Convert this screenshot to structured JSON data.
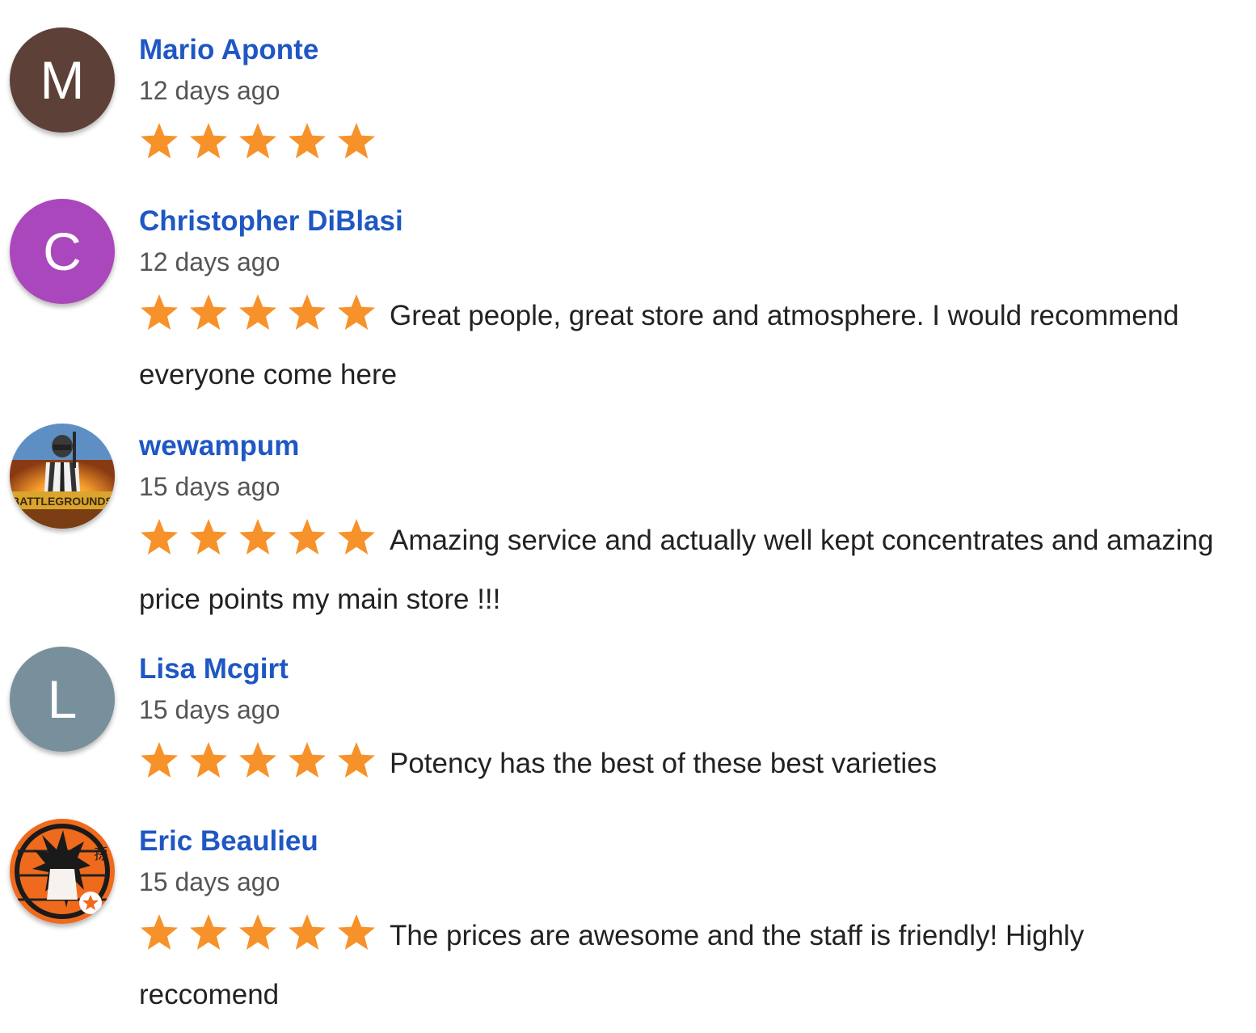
{
  "star_color": "#f7922a",
  "reviews": [
    {
      "name": "Mario Aponte",
      "time": "12 days ago",
      "rating": 5,
      "text": "",
      "avatar": {
        "type": "letter",
        "letter": "M",
        "color": "#5d4037"
      }
    },
    {
      "name": "Christopher DiBlasi",
      "time": "12 days ago",
      "rating": 5,
      "text": "Great people, great store and atmosphere. I would recommend everyone come here",
      "avatar": {
        "type": "letter",
        "letter": "C",
        "color": "#ab47bc"
      }
    },
    {
      "name": "wewampum",
      "time": "15 days ago",
      "rating": 5,
      "text": "Amazing service and actually well kept concentrates and amazing price points my main store !!!",
      "avatar": {
        "type": "photo",
        "icon": "battlegrounds-soldier-photo"
      }
    },
    {
      "name": "Lisa Mcgirt",
      "time": "15 days ago",
      "rating": 5,
      "text": "Potency has the best of these best varieties",
      "avatar": {
        "type": "letter",
        "letter": "L",
        "color": "#78909c"
      }
    },
    {
      "name": "Eric Beaulieu",
      "time": "15 days ago",
      "rating": 5,
      "text": "The prices are awesome and the staff is friendly! Highly reccomend",
      "avatar": {
        "type": "photo",
        "icon": "anime-character-photo"
      }
    }
  ]
}
